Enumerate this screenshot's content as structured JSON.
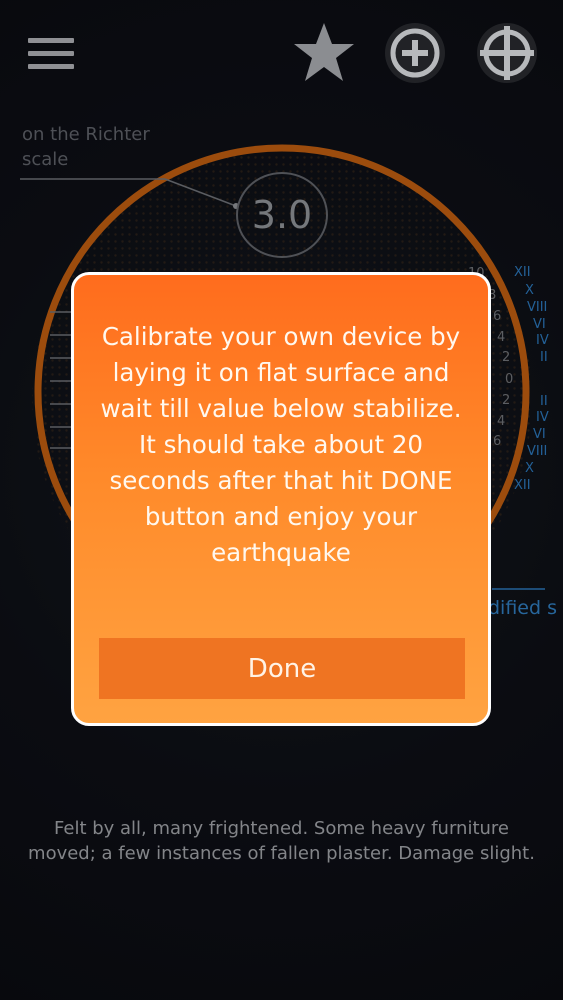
{
  "toolbar": {
    "menu_icon": "hamburger-menu-icon",
    "star_icon": "star-icon",
    "plus_icon": "add-circle-icon",
    "target_icon": "crosshair-target-icon"
  },
  "gauge": {
    "richter_label": "on the Richter scale",
    "mercalli_label": "dified scale",
    "magnitude": "3.0",
    "richter_numbers": [
      "10",
      "8",
      "6",
      "4",
      "2",
      "0",
      "2",
      "4",
      "6"
    ],
    "mercalli_numerals": [
      "XII",
      "X",
      "VIII",
      "VI",
      "IV",
      "II",
      "II",
      "IV",
      "VI",
      "VIII",
      "X",
      "XII"
    ],
    "ring_color": "#b85a10",
    "accent_blue": "#2a72b3"
  },
  "description": "Felt by all, many frightened. Some heavy furniture moved; a few instances of fallen plaster. Damage slight.",
  "modal": {
    "message": "Calibrate your own device by laying it on flat surface and wait till value below stabilize. It should take about 20 seconds after that hit DONE button and enjoy your earthquake",
    "done_label": "Done",
    "background_color": "#ff7a22"
  }
}
